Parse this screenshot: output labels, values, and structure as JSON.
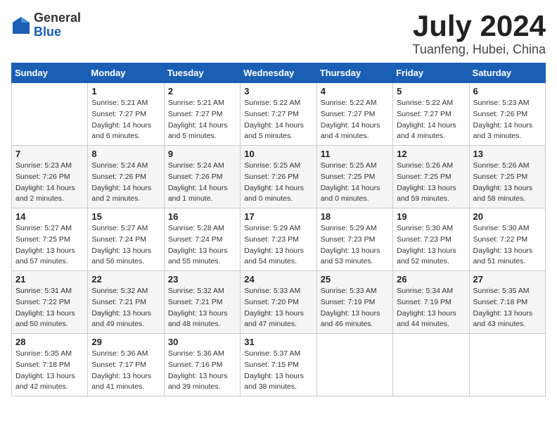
{
  "header": {
    "logo_general": "General",
    "logo_blue": "Blue",
    "month_title": "July 2024",
    "location": "Tuanfeng, Hubei, China"
  },
  "calendar": {
    "weekdays": [
      "Sunday",
      "Monday",
      "Tuesday",
      "Wednesday",
      "Thursday",
      "Friday",
      "Saturday"
    ],
    "weeks": [
      [
        {
          "day": "",
          "detail": ""
        },
        {
          "day": "1",
          "detail": "Sunrise: 5:21 AM\nSunset: 7:27 PM\nDaylight: 14 hours\nand 6 minutes."
        },
        {
          "day": "2",
          "detail": "Sunrise: 5:21 AM\nSunset: 7:27 PM\nDaylight: 14 hours\nand 5 minutes."
        },
        {
          "day": "3",
          "detail": "Sunrise: 5:22 AM\nSunset: 7:27 PM\nDaylight: 14 hours\nand 5 minutes."
        },
        {
          "day": "4",
          "detail": "Sunrise: 5:22 AM\nSunset: 7:27 PM\nDaylight: 14 hours\nand 4 minutes."
        },
        {
          "day": "5",
          "detail": "Sunrise: 5:22 AM\nSunset: 7:27 PM\nDaylight: 14 hours\nand 4 minutes."
        },
        {
          "day": "6",
          "detail": "Sunrise: 5:23 AM\nSunset: 7:26 PM\nDaylight: 14 hours\nand 3 minutes."
        }
      ],
      [
        {
          "day": "7",
          "detail": "Sunrise: 5:23 AM\nSunset: 7:26 PM\nDaylight: 14 hours\nand 2 minutes."
        },
        {
          "day": "8",
          "detail": "Sunrise: 5:24 AM\nSunset: 7:26 PM\nDaylight: 14 hours\nand 2 minutes."
        },
        {
          "day": "9",
          "detail": "Sunrise: 5:24 AM\nSunset: 7:26 PM\nDaylight: 14 hours\nand 1 minute."
        },
        {
          "day": "10",
          "detail": "Sunrise: 5:25 AM\nSunset: 7:26 PM\nDaylight: 14 hours\nand 0 minutes."
        },
        {
          "day": "11",
          "detail": "Sunrise: 5:25 AM\nSunset: 7:25 PM\nDaylight: 14 hours\nand 0 minutes."
        },
        {
          "day": "12",
          "detail": "Sunrise: 5:26 AM\nSunset: 7:25 PM\nDaylight: 13 hours\nand 59 minutes."
        },
        {
          "day": "13",
          "detail": "Sunrise: 5:26 AM\nSunset: 7:25 PM\nDaylight: 13 hours\nand 58 minutes."
        }
      ],
      [
        {
          "day": "14",
          "detail": "Sunrise: 5:27 AM\nSunset: 7:25 PM\nDaylight: 13 hours\nand 57 minutes."
        },
        {
          "day": "15",
          "detail": "Sunrise: 5:27 AM\nSunset: 7:24 PM\nDaylight: 13 hours\nand 56 minutes."
        },
        {
          "day": "16",
          "detail": "Sunrise: 5:28 AM\nSunset: 7:24 PM\nDaylight: 13 hours\nand 55 minutes."
        },
        {
          "day": "17",
          "detail": "Sunrise: 5:29 AM\nSunset: 7:23 PM\nDaylight: 13 hours\nand 54 minutes."
        },
        {
          "day": "18",
          "detail": "Sunrise: 5:29 AM\nSunset: 7:23 PM\nDaylight: 13 hours\nand 53 minutes."
        },
        {
          "day": "19",
          "detail": "Sunrise: 5:30 AM\nSunset: 7:23 PM\nDaylight: 13 hours\nand 52 minutes."
        },
        {
          "day": "20",
          "detail": "Sunrise: 5:30 AM\nSunset: 7:22 PM\nDaylight: 13 hours\nand 51 minutes."
        }
      ],
      [
        {
          "day": "21",
          "detail": "Sunrise: 5:31 AM\nSunset: 7:22 PM\nDaylight: 13 hours\nand 50 minutes."
        },
        {
          "day": "22",
          "detail": "Sunrise: 5:32 AM\nSunset: 7:21 PM\nDaylight: 13 hours\nand 49 minutes."
        },
        {
          "day": "23",
          "detail": "Sunrise: 5:32 AM\nSunset: 7:21 PM\nDaylight: 13 hours\nand 48 minutes."
        },
        {
          "day": "24",
          "detail": "Sunrise: 5:33 AM\nSunset: 7:20 PM\nDaylight: 13 hours\nand 47 minutes."
        },
        {
          "day": "25",
          "detail": "Sunrise: 5:33 AM\nSunset: 7:19 PM\nDaylight: 13 hours\nand 46 minutes."
        },
        {
          "day": "26",
          "detail": "Sunrise: 5:34 AM\nSunset: 7:19 PM\nDaylight: 13 hours\nand 44 minutes."
        },
        {
          "day": "27",
          "detail": "Sunrise: 5:35 AM\nSunset: 7:18 PM\nDaylight: 13 hours\nand 43 minutes."
        }
      ],
      [
        {
          "day": "28",
          "detail": "Sunrise: 5:35 AM\nSunset: 7:18 PM\nDaylight: 13 hours\nand 42 minutes."
        },
        {
          "day": "29",
          "detail": "Sunrise: 5:36 AM\nSunset: 7:17 PM\nDaylight: 13 hours\nand 41 minutes."
        },
        {
          "day": "30",
          "detail": "Sunrise: 5:36 AM\nSunset: 7:16 PM\nDaylight: 13 hours\nand 39 minutes."
        },
        {
          "day": "31",
          "detail": "Sunrise: 5:37 AM\nSunset: 7:15 PM\nDaylight: 13 hours\nand 38 minutes."
        },
        {
          "day": "",
          "detail": ""
        },
        {
          "day": "",
          "detail": ""
        },
        {
          "day": "",
          "detail": ""
        }
      ]
    ]
  }
}
